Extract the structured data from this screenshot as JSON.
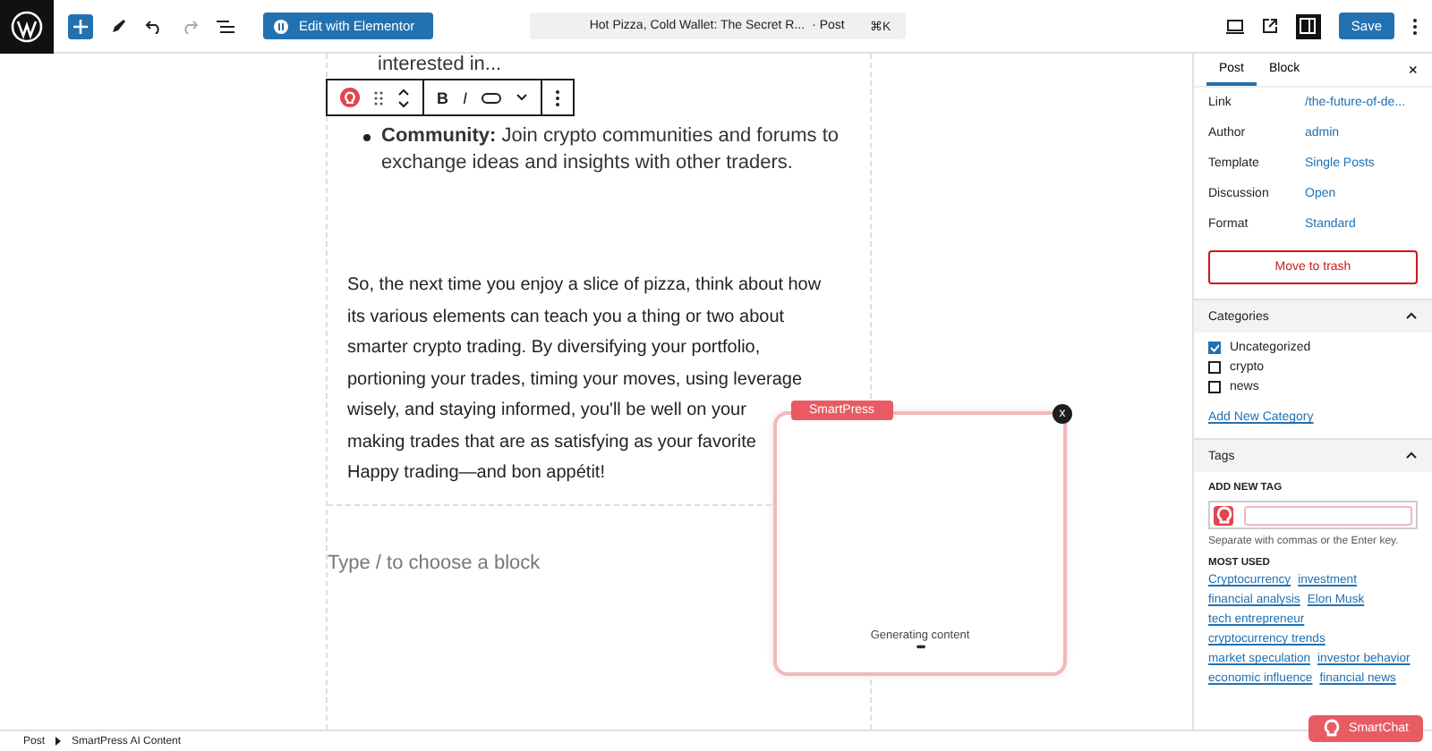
{
  "topbar": {
    "edit_button": "Edit with Elementor",
    "doc_title": "Hot Pizza, Cold Wallet: The Secret R...",
    "doc_type": "· Post",
    "shortcut": "⌘K",
    "save": "Save"
  },
  "block_toolbar": {
    "bold": "B",
    "italic": "I"
  },
  "editor": {
    "cut_line": "interested in...",
    "bullet": {
      "label": "Community:",
      "text": " Join crypto communities and forums to exchange ideas and insights with other traders."
    },
    "paragraph_lines": [
      "So, the next time you enjoy a slice of pizza, think about how",
      "its various elements can teach you a thing or two about",
      "smarter crypto trading. By diversifying your portfolio,",
      "portioning your trades, timing your moves, using leverage",
      "wisely, and staying informed, you'll be well on your",
      "making trades that are as satisfying as your favorite",
      "Happy trading—and bon appétit!"
    ],
    "placeholder": "Type / to choose a block"
  },
  "popup": {
    "badge": "SmartPress",
    "close": "x",
    "status": "Generating content",
    "dots": "•••"
  },
  "sidebar": {
    "tabs": [
      {
        "label": "Post",
        "selected": true
      },
      {
        "label": "Block",
        "selected": false
      }
    ],
    "close": "×",
    "fields": [
      {
        "label": "Link",
        "value": "/the-future-of-de..."
      },
      {
        "label": "Author",
        "value": "admin"
      },
      {
        "label": "Template",
        "value": "Single Posts"
      },
      {
        "label": "Discussion",
        "value": "Open"
      },
      {
        "label": "Format",
        "value": "Standard"
      }
    ],
    "trash": "Move to trash",
    "categories": {
      "title": "Categories",
      "expanded": true,
      "items": [
        {
          "label": "Uncategorized",
          "checked": true
        },
        {
          "label": "crypto",
          "checked": false
        },
        {
          "label": "news",
          "checked": false
        }
      ],
      "add": "Add New Category"
    },
    "tags": {
      "title": "Tags",
      "expanded": true,
      "add_label": "ADD NEW TAG",
      "help": "Separate with commas or the Enter key.",
      "most_used_label": "MOST USED",
      "rows": [
        [
          "Cryptocurrency",
          "investment"
        ],
        [
          "financial analysis",
          "Elon Musk"
        ],
        [
          "tech entrepreneur"
        ],
        [
          "cryptocurrency trends"
        ],
        [
          "market speculation",
          "investor behavior"
        ],
        [
          "economic influence",
          "financial news"
        ]
      ]
    }
  },
  "smartchat": "SmartChat",
  "breadcrumb": [
    "Post",
    "SmartPress AI Content"
  ]
}
